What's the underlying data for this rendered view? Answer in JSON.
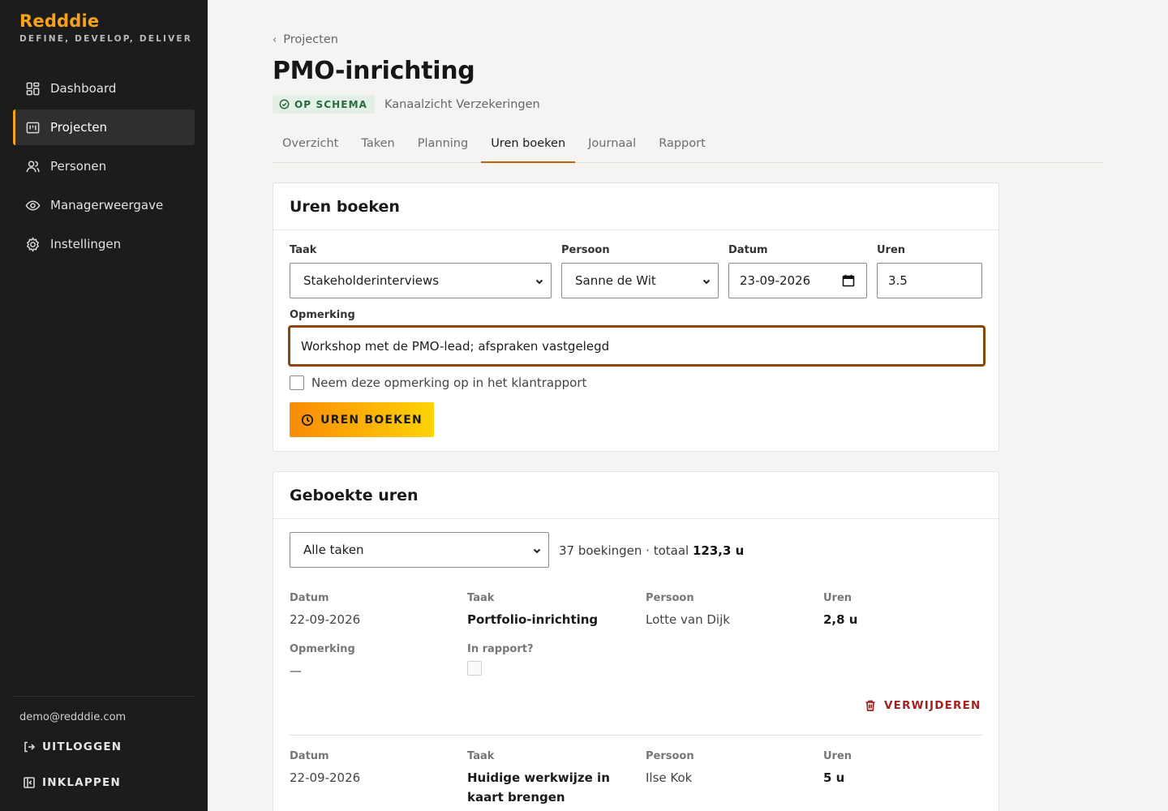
{
  "brand": {
    "name": "Redddie",
    "tagline": "DEFINE, DEVELOP, DELIVER"
  },
  "nav": {
    "items": [
      {
        "label": "Dashboard",
        "icon": "dashboard-icon"
      },
      {
        "label": "Projecten",
        "icon": "kanban-icon",
        "active": true
      },
      {
        "label": "Personen",
        "icon": "users-icon"
      },
      {
        "label": "Managerweergave",
        "icon": "eye-icon"
      },
      {
        "label": "Instellingen",
        "icon": "gear-icon"
      }
    ]
  },
  "account": {
    "email": "demo@redddie.com",
    "logout_label": "UITLOGGEN",
    "collapse_label": "INKLAPPEN"
  },
  "header": {
    "breadcrumb": "Projecten",
    "title": "PMO-inrichting",
    "status": "OP SCHEMA",
    "client": "Kanaalzicht Verzekeringen"
  },
  "tabs": [
    {
      "label": "Overzicht"
    },
    {
      "label": "Taken"
    },
    {
      "label": "Planning"
    },
    {
      "label": "Uren boeken",
      "active": true
    },
    {
      "label": "Journaal"
    },
    {
      "label": "Rapport"
    }
  ],
  "form": {
    "title": "Uren boeken",
    "task_label": "Taak",
    "task_value": "Stakeholderinterviews",
    "person_label": "Persoon",
    "person_value": "Sanne de Wit",
    "date_label": "Datum",
    "date_value": "23-09-2026",
    "hours_label": "Uren",
    "hours_value": "3.5",
    "remark_label": "Opmerking",
    "remark_value": "Workshop met de PMO-lead; afspraken vastgelegd",
    "include_label": "Neem deze opmerking op in het klantrapport",
    "submit_label": "UREN BOEKEN"
  },
  "booked": {
    "title": "Geboekte uren",
    "filter_value": "Alle taken",
    "summary_prefix": "37 boekingen · totaal ",
    "summary_total": "123,3 u",
    "labels": {
      "date": "Datum",
      "task": "Taak",
      "person": "Persoon",
      "hours": "Uren",
      "remark": "Opmerking",
      "in_report": "In rapport?"
    },
    "delete_label": "VERWIJDEREN",
    "entries": [
      {
        "date": "22-09-2026",
        "task": "Portfolio-inrichting",
        "person": "Lotte van Dijk",
        "hours": "2,8 u",
        "remark": "—"
      },
      {
        "date": "22-09-2026",
        "task": "Huidige werkwijze in kaart brengen",
        "person": "Ilse Kok",
        "hours": "5 u"
      }
    ]
  },
  "colors": {
    "accent": "#f7a21b",
    "sidebar": "#1c1c1c",
    "focus": "#8a4708",
    "danger": "#a32222",
    "status_bg": "#e4efe6"
  }
}
